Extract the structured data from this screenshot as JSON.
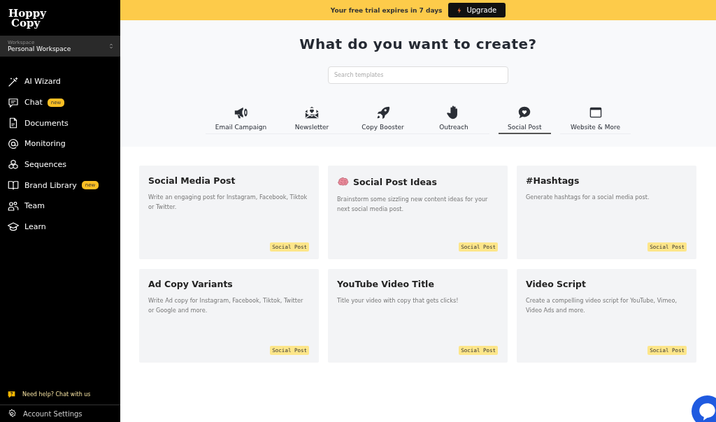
{
  "sidebar": {
    "logo": [
      "Hoppy",
      "Copy"
    ],
    "workspace": {
      "label": "Workspace",
      "value": "Personal Workspace"
    },
    "items": [
      {
        "label": "AI Wizard"
      },
      {
        "label": "Chat",
        "badge": "new"
      },
      {
        "label": "Documents"
      },
      {
        "label": "Monitoring"
      },
      {
        "label": "Sequences"
      },
      {
        "label": "Brand Library",
        "badge": "new"
      },
      {
        "label": "Team"
      },
      {
        "label": "Learn"
      }
    ],
    "help": "Need help? Chat with us",
    "settings": "Account Settings"
  },
  "banner": {
    "text": "Your free trial expires in 7 days",
    "button": "Upgrade"
  },
  "heading": "What do you want to create?",
  "search": {
    "placeholder": "Search templates"
  },
  "categories": [
    {
      "label": "Email Campaign",
      "selected": false
    },
    {
      "label": "Newsletter",
      "selected": false
    },
    {
      "label": "Copy Booster",
      "selected": false
    },
    {
      "label": "Outreach",
      "selected": false
    },
    {
      "label": "Social Post",
      "selected": true
    },
    {
      "label": "Website & More",
      "selected": false
    }
  ],
  "templates": [
    {
      "title": "Social Media Post",
      "description": "Write an engaging post for Instagram, Facebook, Tiktok or Twitter.",
      "tag": "Social Post",
      "brain_icon": false
    },
    {
      "title": "Social Post Ideas",
      "description": "Brainstorm some sizzling new content ideas for your next social media post.",
      "tag": "Social Post",
      "brain_icon": true
    },
    {
      "title": "#Hashtags",
      "description": "Generate hashtags for a social media post.",
      "tag": "Social Post",
      "brain_icon": false
    },
    {
      "title": "Ad Copy Variants",
      "description": "Write Ad copy for Instagram, Facebook, Tiktok, Twitter or Google and more.",
      "tag": "Social Post",
      "brain_icon": false
    },
    {
      "title": "YouTube Video Title",
      "description": "Title your video with copy that gets clicks!",
      "tag": "Social Post",
      "brain_icon": false
    },
    {
      "title": "Video Script",
      "description": "Create a compelling video script for YouTube, Vimeo, Video Ads and more.",
      "tag": "Social Post",
      "brain_icon": false
    }
  ]
}
